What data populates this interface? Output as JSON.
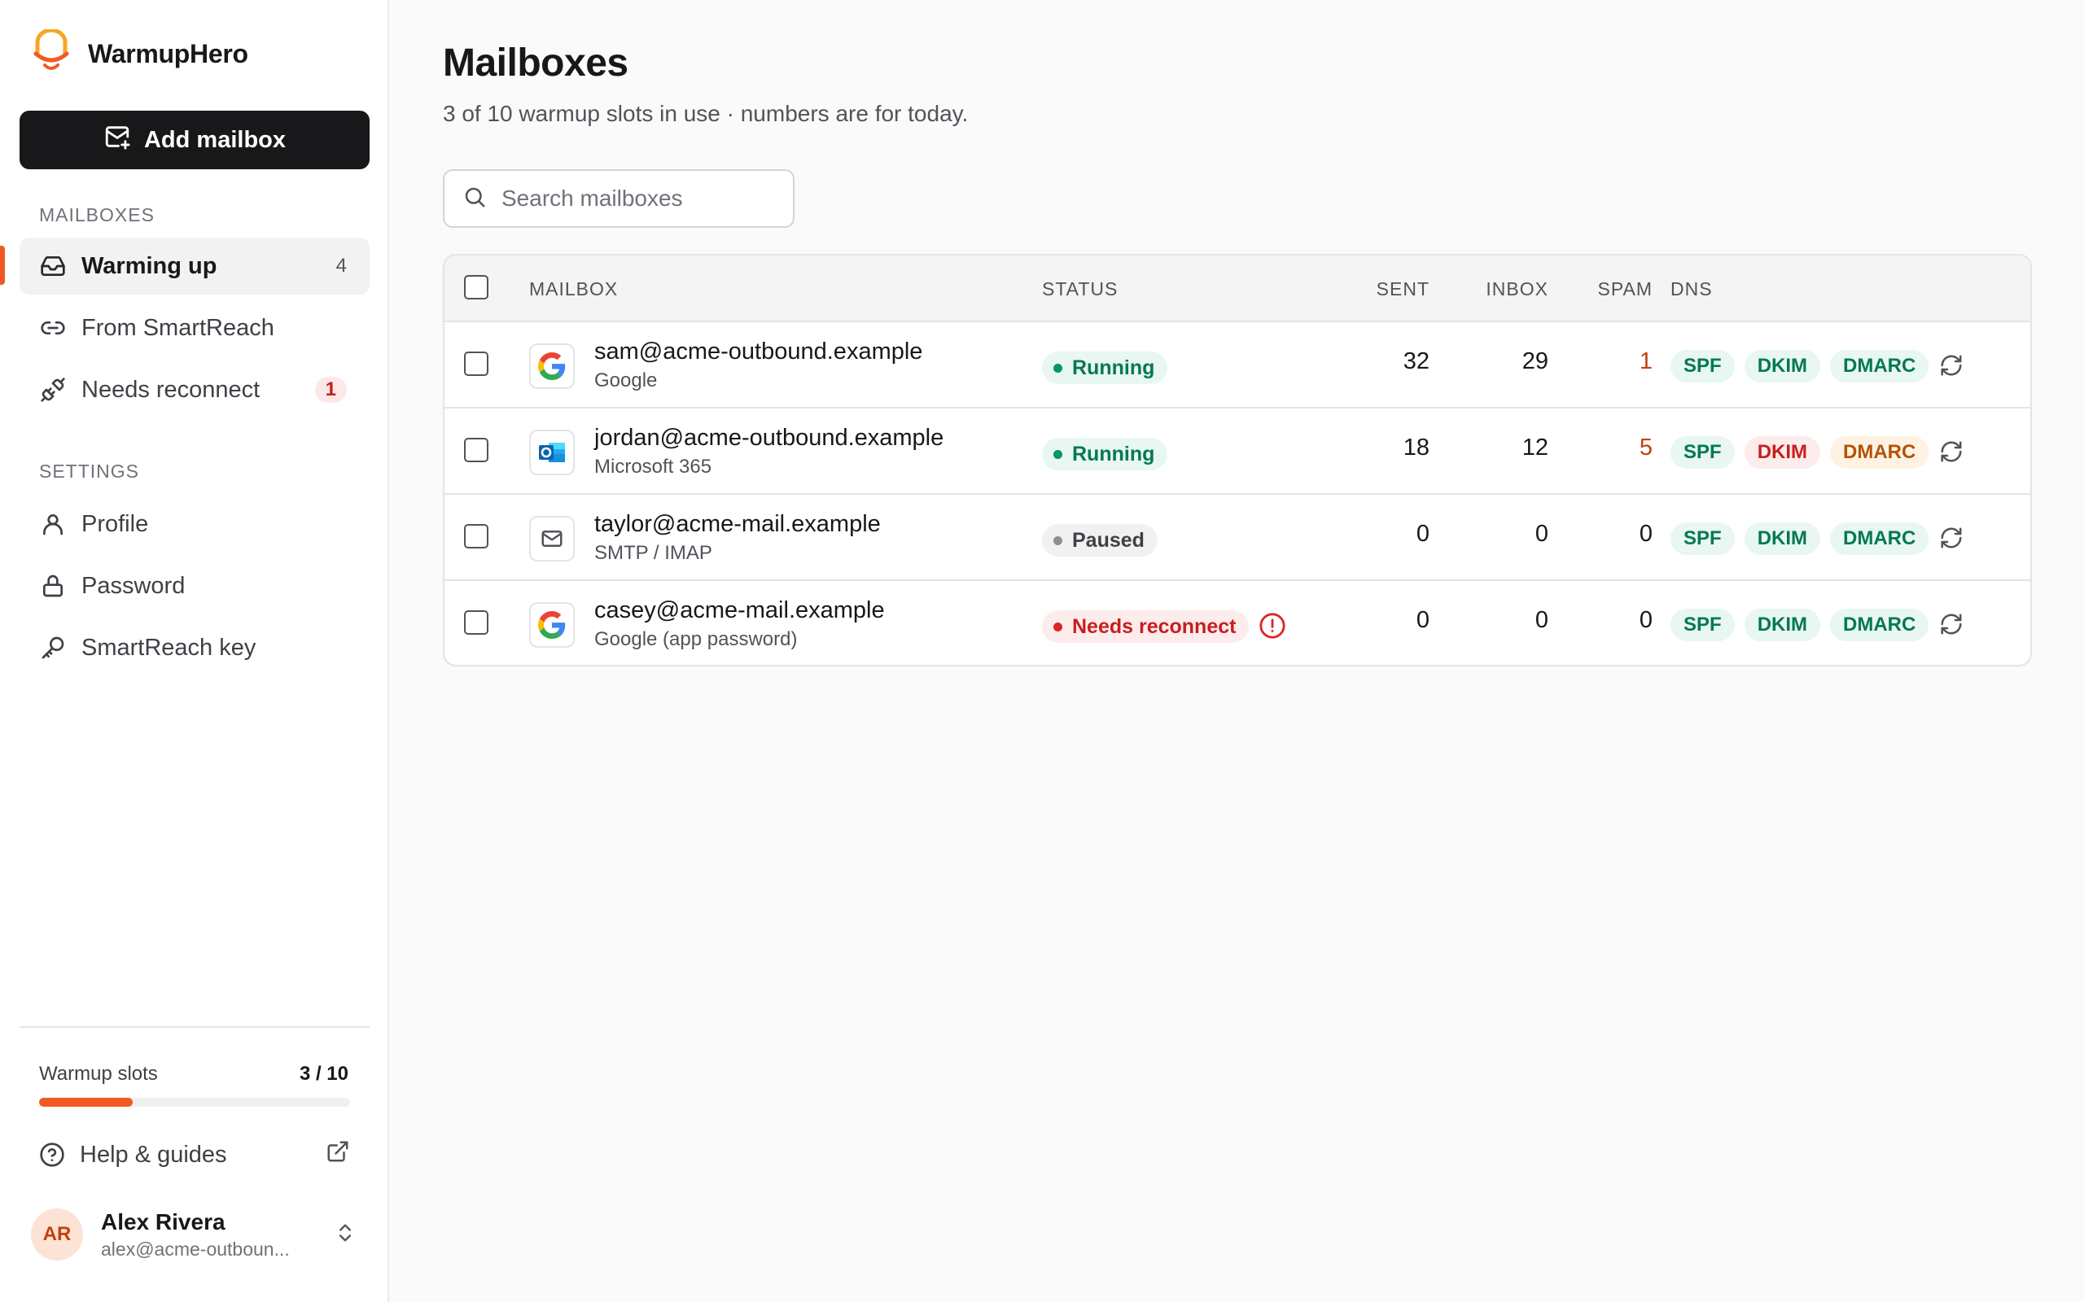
{
  "brand": {
    "name": "WarmupHero"
  },
  "sidebar": {
    "add_button": "Add mailbox",
    "mailboxes_section": "MAILBOXES",
    "mailbox_items": [
      {
        "label": "Warming up",
        "count": "4",
        "icon": "inbox-icon"
      },
      {
        "label": "From SmartReach",
        "count": "",
        "icon": "link-icon"
      },
      {
        "label": "Needs reconnect",
        "count": "1",
        "icon": "plug-icon"
      }
    ],
    "settings_section": "SETTINGS",
    "settings_items": [
      {
        "label": "Profile",
        "icon": "user-icon"
      },
      {
        "label": "Password",
        "icon": "lock-icon"
      },
      {
        "label": "SmartReach key",
        "icon": "key-icon"
      }
    ],
    "slots": {
      "label": "Warmup slots",
      "value": "3 / 10",
      "used": 3,
      "total": 10
    },
    "help": {
      "label": "Help & guides"
    },
    "user": {
      "initials": "AR",
      "name": "Alex Rivera",
      "email": "alex@acme-outboun..."
    }
  },
  "main": {
    "title": "Mailboxes",
    "subtitle": "3 of 10 warmup slots in use · numbers are for today.",
    "search": {
      "placeholder": "Search mailboxes",
      "value": ""
    },
    "table": {
      "headers": {
        "mailbox": "MAILBOX",
        "status": "STATUS",
        "sent": "SENT",
        "inbox": "INBOX",
        "spam": "SPAM",
        "dns": "DNS"
      },
      "rows": [
        {
          "email": "sam@acme-outbound.example",
          "provider": "Google",
          "provider_icon": "google-icon",
          "status": "Running",
          "status_kind": "running",
          "sent": "32",
          "inbox": "29",
          "spam": "1",
          "dns": {
            "spf": "SPF",
            "dkim": "DKIM",
            "dmarc": "DMARC"
          },
          "dns_state": {
            "spf": "ok",
            "dkim": "ok",
            "dmarc": "ok"
          }
        },
        {
          "email": "jordan@acme-outbound.example",
          "provider": "Microsoft 365",
          "provider_icon": "outlook-icon",
          "status": "Running",
          "status_kind": "running",
          "sent": "18",
          "inbox": "12",
          "spam": "5",
          "dns": {
            "spf": "SPF",
            "dkim": "DKIM",
            "dmarc": "DMARC"
          },
          "dns_state": {
            "spf": "ok",
            "dkim": "fail",
            "dmarc": "warn"
          }
        },
        {
          "email": "taylor@acme-mail.example",
          "provider": "SMTP / IMAP",
          "provider_icon": "mail-icon",
          "status": "Paused",
          "status_kind": "paused",
          "sent": "0",
          "inbox": "0",
          "spam": "0",
          "dns": {
            "spf": "SPF",
            "dkim": "DKIM",
            "dmarc": "DMARC"
          },
          "dns_state": {
            "spf": "ok",
            "dkim": "ok",
            "dmarc": "ok"
          }
        },
        {
          "email": "casey@acme-mail.example",
          "provider": "Google (app password)",
          "provider_icon": "google-icon",
          "status": "Needs reconnect",
          "status_kind": "error",
          "sent": "0",
          "inbox": "0",
          "spam": "0",
          "dns": {
            "spf": "SPF",
            "dkim": "DKIM",
            "dmarc": "DMARC"
          },
          "dns_state": {
            "spf": "ok",
            "dkim": "ok",
            "dmarc": "ok"
          }
        }
      ]
    }
  },
  "colors": {
    "accent": "#f05a22",
    "success": "#047857",
    "danger": "#c81e1e",
    "warning": "#c2410c",
    "dark": "#18181b"
  }
}
